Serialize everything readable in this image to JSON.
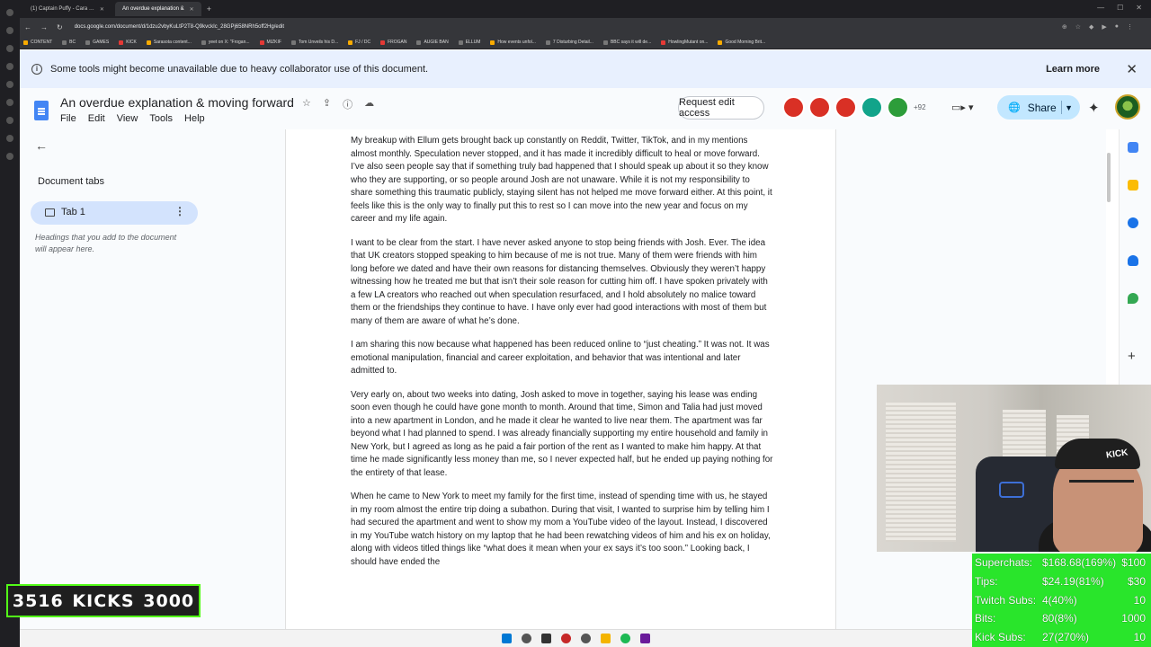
{
  "browser": {
    "tabs": [
      {
        "label": "(1) Captain Puffy - Cara …",
        "active": false
      },
      {
        "label": "An overdue explanation &",
        "active": true
      }
    ],
    "url": "docs.google.com/document/d/1dzu2vbyKuLtP2T8-Q9kvckIc_28GPj658NRh5off2Hg/edit",
    "bookmarks": [
      "CONTENT",
      "BC",
      "GAMES",
      "KICK",
      "Sarasota content...",
      "yeet on X: \"Frogan...",
      "MIZKIF",
      "Tom Unveils his D...",
      "FJ / DC",
      "FROGAN",
      "AUGIE BAN",
      "ELLUM",
      "How events unfol...",
      "7 Disturbing Detail...",
      "BBC says it will de...",
      "HowlingMutant on...",
      "Good Morning Brit..."
    ]
  },
  "banner": {
    "message": "Some tools might become unavailable due to heavy collaborator use of this document.",
    "learn_more": "Learn more"
  },
  "doc": {
    "title": "An overdue explanation & moving forward",
    "menu": [
      "File",
      "Edit",
      "View",
      "Tools",
      "Help"
    ],
    "request_edit": "Request edit access",
    "more_collaborators": "+92",
    "share": "Share"
  },
  "sidebar": {
    "heading": "Document tabs",
    "tab_label": "Tab 1",
    "hint": "Headings that you add to the document will appear here."
  },
  "paragraphs": [
    "My breakup with Ellum gets brought back up constantly on Reddit, Twitter, TikTok, and in my mentions almost monthly. Speculation never stopped, and it has made it incredibly difficult to heal or move forward. I’ve also seen people say that if something truly bad happened that I should speak up about it so they know who they are supporting, or so people around Josh are not unaware. While it is not my responsibility to share something this traumatic publicly, staying silent has not helped me move forward either. At this point, it feels like this is the only way to finally put this to rest so I can move into the new year and focus on my career and my life again.",
    "I want to be clear from the start. I have never asked anyone to stop being friends with Josh. Ever. The idea that UK creators stopped speaking to him because of me is not true. Many of them were friends with him long before we dated and have their own reasons for distancing themselves. Obviously they weren’t happy witnessing how he treated me but that isn’t their sole reason for cutting him off. I have spoken privately with a few LA creators who reached out when speculation resurfaced, and I hold absolutely no malice toward them or the friendships they continue to have. I have only ever had good interactions with most of them but many of them are aware of what he’s done.",
    "I am sharing this now because what happened has been reduced online to “just cheating.” It was not. It was emotional manipulation, financial and career exploitation, and behavior that was intentional and later admitted to.",
    "Very early on, about two weeks into dating, Josh asked to move in together, saying his lease was ending soon even though he could have gone month to month. Around that time, Simon and Talia had just moved into a new apartment in London, and he made it clear he wanted to live near them. The apartment was far beyond what I had planned to spend. I was already financially supporting my entire household and family in New York, but I agreed as long as he paid a fair portion of the rent as I wanted to make him happy. At that time he made significantly less money than me, so I never expected half, but he ended up paying nothing for the entirety of that lease.",
    "When he came to New York to meet my family for the first time, instead of spending time with us, he stayed in my room almost the entire trip doing a subathon. During that visit, I wanted to surprise him by telling him I had secured the apartment and went to show my mom a YouTube video of the layout. Instead, I discovered in my YouTube watch history on my laptop that he had been rewatching videos of him and his ex on holiday, along with videos titled things like “what does it mean when your ex says it’s too soon.” Looking back, I should have ended the"
  ],
  "webcam": {
    "hat_text": "KICK"
  },
  "kicks_bar": {
    "current": "3516",
    "label": "KICKS",
    "goal": "3000"
  },
  "stats": [
    {
      "label": "Superchats:",
      "progress": "$168.68(169%)",
      "goal": "$100"
    },
    {
      "label": "Tips:",
      "progress": "$24.19(81%)",
      "goal": "$30"
    },
    {
      "label": "Twitch Subs:",
      "progress": "4(40%)",
      "goal": "10"
    },
    {
      "label": "Bits:",
      "progress": "80(8%)",
      "goal": "1000"
    },
    {
      "label": "Kick Subs:",
      "progress": "27(270%)",
      "goal": "10"
    }
  ],
  "colors": {
    "banner_bg": "#e8f0fe",
    "share_bg": "#c2e7ff",
    "tab_active_bg": "#d3e3fd",
    "kick_green": "#53fc18",
    "stats_green": "#29e52b"
  }
}
